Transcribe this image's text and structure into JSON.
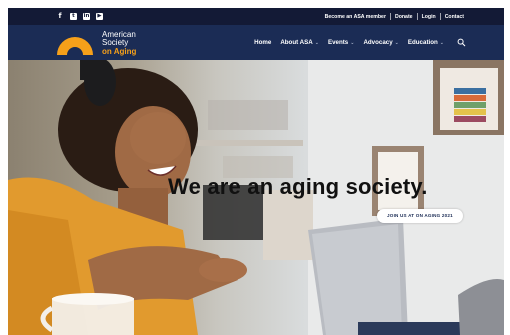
{
  "topbar": {
    "social_icons": [
      {
        "icon": "facebook-icon",
        "glyph": "f"
      },
      {
        "icon": "twitter-icon",
        "glyph": "t"
      },
      {
        "icon": "linkedin-icon",
        "glyph": "in"
      },
      {
        "icon": "youtube-icon",
        "glyph": "▶"
      }
    ],
    "links": {
      "become_member": "Become an ASA member",
      "donate": "Donate",
      "login": "Login",
      "contact": "Contact"
    }
  },
  "logo": {
    "line1": "American",
    "line2": "Society",
    "line3": "on Aging",
    "accent_color": "#f6a01a"
  },
  "nav": {
    "home": "Home",
    "about": "About ASA",
    "events": "Events",
    "advocacy": "Advocacy",
    "education": "Education",
    "search_icon": "search-icon"
  },
  "hero": {
    "title": "We are an aging society.",
    "cta": "JOIN US AT ON AGING 2021"
  },
  "colors": {
    "topbar_bg": "#131a36",
    "navbar_bg": "#1b2c55",
    "accent": "#f6a01a",
    "cta_text": "#1b2c55"
  }
}
